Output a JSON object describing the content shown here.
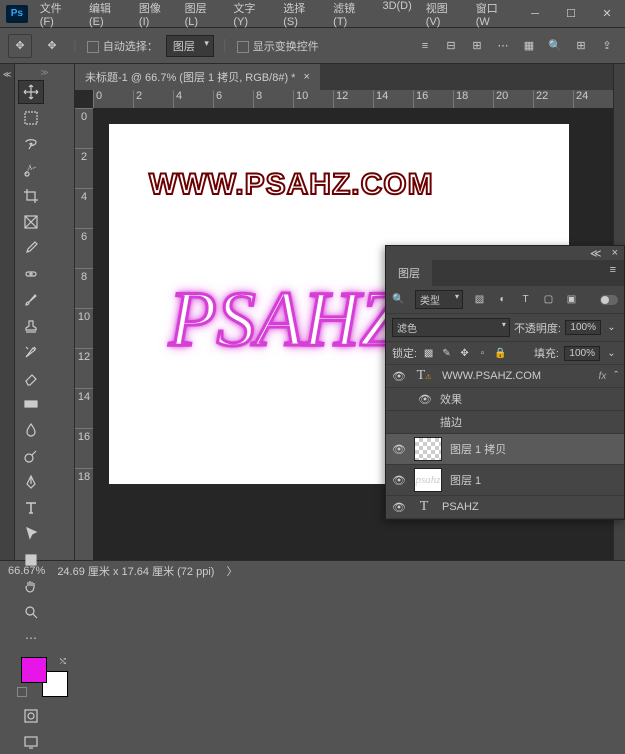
{
  "menu": [
    "文件(F)",
    "编辑(E)",
    "图像(I)",
    "图层(L)",
    "文字(Y)",
    "选择(S)",
    "滤镜(T)",
    "3D(D)",
    "视图(V)",
    "窗口(W"
  ],
  "optbar": {
    "auto": "自动选择：",
    "target": "图层",
    "transform": "显示变换控件"
  },
  "doc": {
    "title": "未标题-1 @ 66.7% (图层 1 拷贝, RGB/8#) *"
  },
  "rulerH": [
    "0",
    "2",
    "4",
    "6",
    "8",
    "10",
    "12",
    "14",
    "16",
    "18",
    "20",
    "22",
    "24"
  ],
  "rulerV": [
    "0",
    "2",
    "4",
    "6",
    "8",
    "10",
    "12",
    "14",
    "16",
    "18"
  ],
  "canvas": {
    "outline": "WWW.PSAHZ.COM",
    "neon": "PSAHZ"
  },
  "status": {
    "zoom": "66.67%",
    "dims": "24.69 厘米 x 17.64 厘米 (72 ppi)"
  },
  "panel": {
    "tab": "图层",
    "kind": "类型",
    "blend": "滤色",
    "opacityL": "不透明度:",
    "opacity": "100%",
    "lockL": "锁定:",
    "fillL": "填充:",
    "fill": "100%",
    "layers": [
      {
        "eye": "👁",
        "type": "T",
        "warn": true,
        "name": "WWW.PSAHZ.COM",
        "fx": true
      },
      {
        "sub": true,
        "eye": "👁",
        "name": "效果"
      },
      {
        "sub": true,
        "eye": "",
        "name": "描边"
      },
      {
        "eye": "👁",
        "thumb": "chk",
        "name": "图层 1 拷贝",
        "sel": true
      },
      {
        "eye": "👁",
        "thumb": "neon",
        "name": "图层 1"
      },
      {
        "eye": "👁",
        "type": "T",
        "name": "PSAHZ"
      }
    ]
  }
}
